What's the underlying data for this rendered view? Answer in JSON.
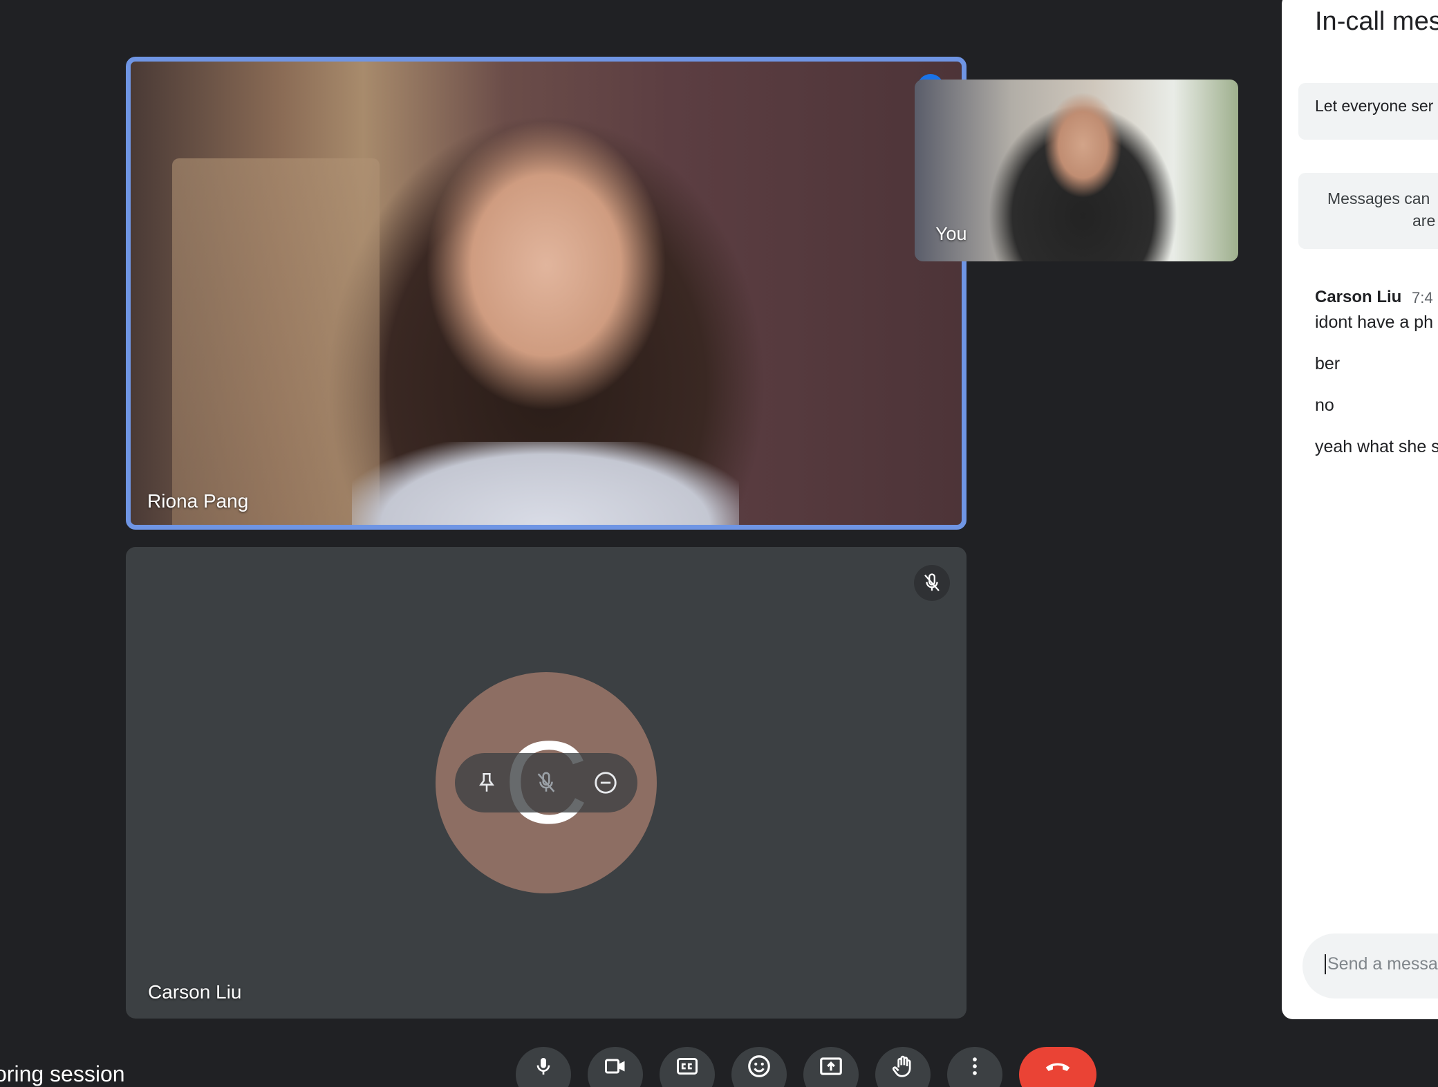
{
  "tiles": {
    "main_name": "Riona Pang",
    "self_name": "You",
    "second_name": "Carson Liu",
    "second_avatar_letter": "C"
  },
  "meeting": {
    "title_partial": "oring session"
  },
  "controls": {
    "items": [
      "mic",
      "camera",
      "captions",
      "emoji",
      "present",
      "raise-hand",
      "more-options",
      "end-call"
    ],
    "end_call_color": "#ea4335",
    "button_color": "#3c4043"
  },
  "chat": {
    "title": "In-call mes",
    "toggle_label": "Let everyone ser",
    "info_line1": "Messages can",
    "info_line2": "are",
    "sender": "Carson Liu",
    "time": "7:4",
    "messages": [
      "idont have a ph",
      "ber",
      "no",
      "yeah what she s"
    ],
    "input_placeholder": "Send a messa"
  },
  "colors": {
    "background": "#202124",
    "active_speaker_border": "#6f95e4",
    "avatar_bg": "#8d6e63",
    "tile_bg": "#3c4043"
  }
}
